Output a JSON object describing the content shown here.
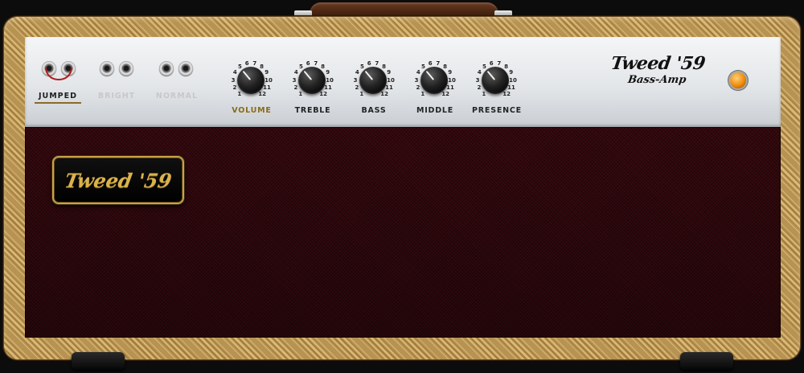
{
  "amp": {
    "brand": "Tweed '59",
    "model": "Bass-Amp",
    "badge": "Tweed '59"
  },
  "channels": [
    {
      "label": "JUMPED",
      "selected": true
    },
    {
      "label": "BRIGHT",
      "selected": false
    },
    {
      "label": "NORMAL",
      "selected": false
    }
  ],
  "knobs": [
    {
      "label": "VOLUME",
      "active": true
    },
    {
      "label": "TREBLE",
      "active": false
    },
    {
      "label": "BASS",
      "active": false
    },
    {
      "label": "MIDDLE",
      "active": false
    },
    {
      "label": "PRESENCE",
      "active": false
    }
  ],
  "scale": [
    "1",
    "2",
    "3",
    "4",
    "5",
    "6",
    "7",
    "8",
    "9",
    "10",
    "11",
    "12"
  ],
  "colors": {
    "tweed": "#d8b874",
    "grille": "#3a0a10",
    "badge_gold": "#d9b24c",
    "pilot_lamp": "#f08a0a",
    "active_label": "#8a6a1a"
  }
}
